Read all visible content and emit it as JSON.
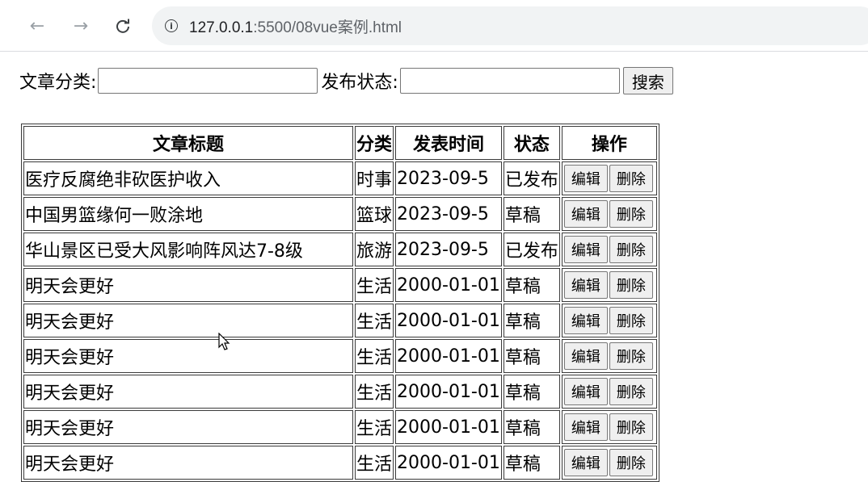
{
  "browser": {
    "url_host": "127.0.0.1",
    "url_rest": ":5500/08vue案例.html"
  },
  "search": {
    "category_label": "文章分类:",
    "category_value": "",
    "status_label": "发布状态:",
    "status_value": "",
    "button_label": "搜索"
  },
  "table": {
    "headers": [
      "文章标题",
      "分类",
      "发表时间",
      "状态",
      "操作"
    ],
    "edit_label": "编辑",
    "delete_label": "删除",
    "rows": [
      {
        "title": "医疗反腐绝非砍医护收入",
        "category": "时事",
        "time": "2023-09-5",
        "status": "已发布"
      },
      {
        "title": "中国男篮缘何一败涂地",
        "category": "篮球",
        "time": "2023-09-5",
        "status": "草稿"
      },
      {
        "title": "华山景区已受大风影响阵风达7-8级",
        "category": "旅游",
        "time": "2023-09-5",
        "status": "已发布"
      },
      {
        "title": "明天会更好",
        "category": "生活",
        "time": "2000-01-01",
        "status": "草稿"
      },
      {
        "title": "明天会更好",
        "category": "生活",
        "time": "2000-01-01",
        "status": "草稿"
      },
      {
        "title": "明天会更好",
        "category": "生活",
        "time": "2000-01-01",
        "status": "草稿"
      },
      {
        "title": "明天会更好",
        "category": "生活",
        "time": "2000-01-01",
        "status": "草稿"
      },
      {
        "title": "明天会更好",
        "category": "生活",
        "time": "2000-01-01",
        "status": "草稿"
      },
      {
        "title": "明天会更好",
        "category": "生活",
        "time": "2000-01-01",
        "status": "草稿"
      }
    ]
  },
  "icons": {
    "back": "back-arrow-icon",
    "forward": "forward-arrow-icon",
    "reload": "reload-icon",
    "info": "info-icon",
    "cursor": "mouse-cursor-icon"
  }
}
